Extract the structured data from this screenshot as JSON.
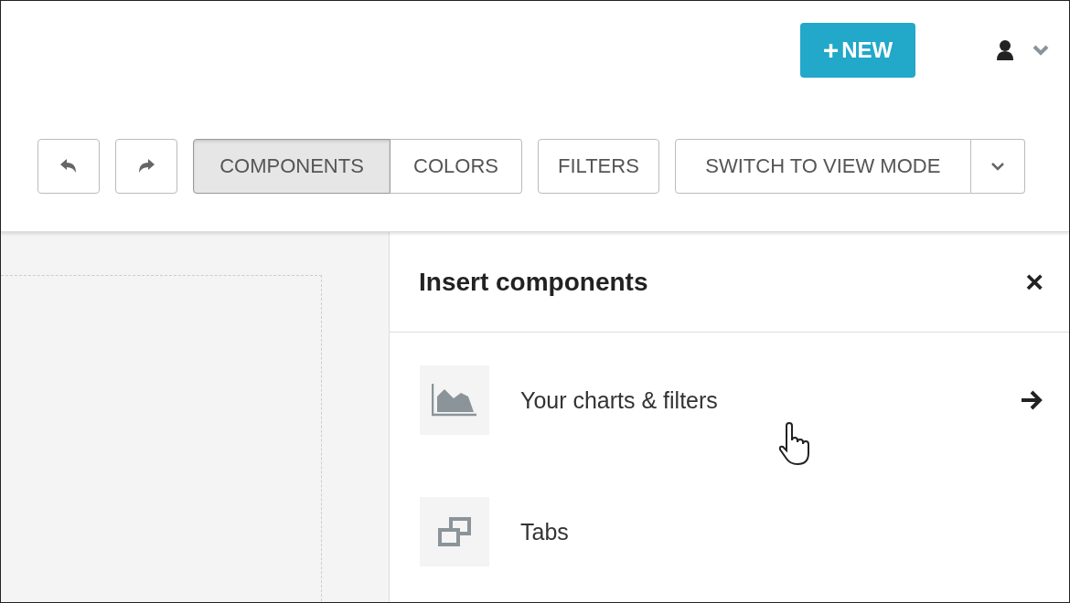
{
  "header": {
    "new_button": {
      "icon": "+",
      "label": "NEW"
    }
  },
  "toolbar": {
    "segments": [
      {
        "label": "COMPONENTS",
        "selected": true
      },
      {
        "label": "COLORS",
        "selected": false
      }
    ],
    "filters_button": "FILTERS",
    "mode_button": "SWITCH TO VIEW MODE"
  },
  "panel": {
    "title": "Insert components",
    "close": "×",
    "items": [
      {
        "kind": "chart",
        "label": "Your charts & filters",
        "arrow": true
      },
      {
        "kind": "tabs",
        "label": "Tabs",
        "arrow": false
      }
    ]
  }
}
